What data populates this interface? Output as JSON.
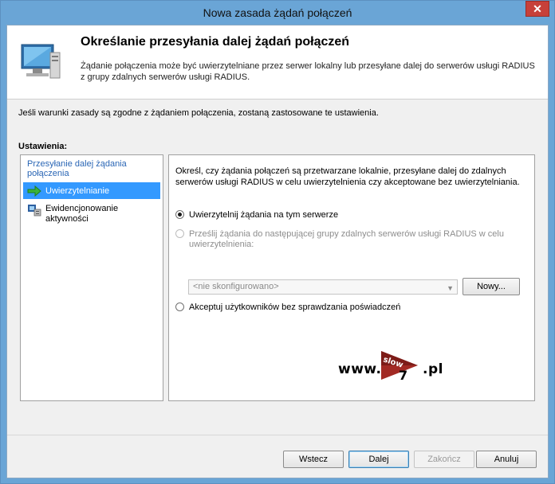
{
  "window": {
    "title": "Nowa zasada żądań połączeń",
    "close_glyph": "✕"
  },
  "header": {
    "title": "Określanie przesyłania dalej żądań połączeń",
    "description": "Żądanie połączenia może być uwierzytelniane przez serwer lokalny lub przesyłane dalej do serwerów usługi RADIUS z grupy zdalnych serwerów usługi RADIUS.",
    "icon": "server-monitor-icon"
  },
  "intro_text": "Jeśli warunki zasady są zgodne z żądaniem połączenia, zostaną zastosowane te ustawienia.",
  "settings_label": "Ustawienia:",
  "left_pane": {
    "heading": "Przesyłanie dalej żądania połączenia",
    "items": [
      {
        "label": "Uwierzytelnianie",
        "icon": "green-arrow-icon",
        "selected": true
      },
      {
        "label": "Ewidencjonowanie aktywności",
        "icon": "accounting-icon",
        "selected": false
      }
    ]
  },
  "right_pane": {
    "description": "Określ, czy żądania połączeń są przetwarzane lokalnie, przesyłane dalej do zdalnych serwerów usługi RADIUS w celu uwierzytelnienia czy akceptowane bez uwierzytelniania.",
    "options": [
      {
        "label": "Uwierzytelnij żądania na tym serwerze",
        "checked": true,
        "enabled": true
      },
      {
        "label": "Prześlij żądania do następującej grupy zdalnych serwerów usługi RADIUS w celu uwierzytelnienia:",
        "checked": false,
        "enabled": false
      },
      {
        "label": "Akceptuj użytkowników bez sprawdzania poświadczeń",
        "checked": false,
        "enabled": true
      }
    ],
    "server_group_select": {
      "value": "<nie skonfigurowano>",
      "enabled": false
    },
    "new_button": "Nowy..."
  },
  "watermark": {
    "prefix": "www.",
    "badge_top": "slow",
    "badge_bottom": "7",
    "suffix": ".pl"
  },
  "buttons": {
    "back": "Wstecz",
    "next": "Dalej",
    "finish": "Zakończ",
    "cancel": "Anuluj"
  }
}
